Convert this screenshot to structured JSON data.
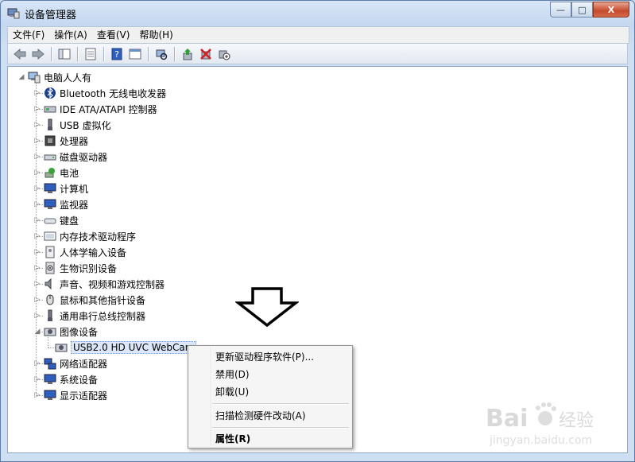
{
  "window": {
    "title": "设备管理器",
    "controls": {
      "minimize": "—",
      "maximize": "□",
      "close": "X"
    }
  },
  "menu": [
    "文件(F)",
    "操作(A)",
    "查看(V)",
    "帮助(H)"
  ],
  "toolbar": [
    "back-arrow-icon",
    "forward-arrow-icon",
    "console-tree-icon",
    "properties-icon",
    "help-icon",
    "console-view-icon",
    "scan-hardware-icon",
    "update-driver-icon",
    "uninstall-icon",
    "disable-icon"
  ],
  "tree": {
    "root": "电脑人人有",
    "items": [
      {
        "label": "Bluetooth 无线电收发器",
        "icon": "bluetooth-icon"
      },
      {
        "label": "IDE ATA/ATAPI 控制器",
        "icon": "ide-controller-icon"
      },
      {
        "label": "USB 虚拟化",
        "icon": "usb-icon"
      },
      {
        "label": "处理器",
        "icon": "processor-icon"
      },
      {
        "label": "磁盘驱动器",
        "icon": "disk-drive-icon"
      },
      {
        "label": "电池",
        "icon": "battery-icon"
      },
      {
        "label": "计算机",
        "icon": "computer-icon"
      },
      {
        "label": "监视器",
        "icon": "monitor-icon"
      },
      {
        "label": "键盘",
        "icon": "keyboard-icon"
      },
      {
        "label": "内存技术驱动程序",
        "icon": "memory-tech-icon"
      },
      {
        "label": "人体学输入设备",
        "icon": "hid-icon"
      },
      {
        "label": "生物识别设备",
        "icon": "biometric-icon"
      },
      {
        "label": "声音、视频和游戏控制器",
        "icon": "sound-icon"
      },
      {
        "label": "鼠标和其他指针设备",
        "icon": "mouse-icon"
      },
      {
        "label": "通用串行总线控制器",
        "icon": "usb-controller-icon"
      },
      {
        "label": "图像设备",
        "icon": "imaging-device-icon",
        "expanded": true
      },
      {
        "label": "USB2.0 HD UVC WebCam",
        "icon": "webcam-icon",
        "child": true,
        "selected": true
      },
      {
        "label": "网络适配器",
        "icon": "network-adapter-icon"
      },
      {
        "label": "系统设备",
        "icon": "system-device-icon"
      },
      {
        "label": "显示适配器",
        "icon": "display-adapter-icon"
      }
    ]
  },
  "context_menu": {
    "items": [
      {
        "label": "更新驱动程序软件(P)...",
        "bold": false
      },
      {
        "label": "禁用(D)",
        "bold": false
      },
      {
        "label": "卸载(U)",
        "bold": false
      },
      {
        "label": "扫描检测硬件改动(A)",
        "bold": false
      },
      {
        "label": "属性(R)",
        "bold": true
      }
    ]
  },
  "watermark": {
    "brand": "Bai",
    "brand2": "经验",
    "url": "jingyan.baidu.com"
  },
  "colors": {
    "title_bg": "#c5d8f0",
    "close_btn": "#c44a2b",
    "selection": "#dce8fa"
  }
}
